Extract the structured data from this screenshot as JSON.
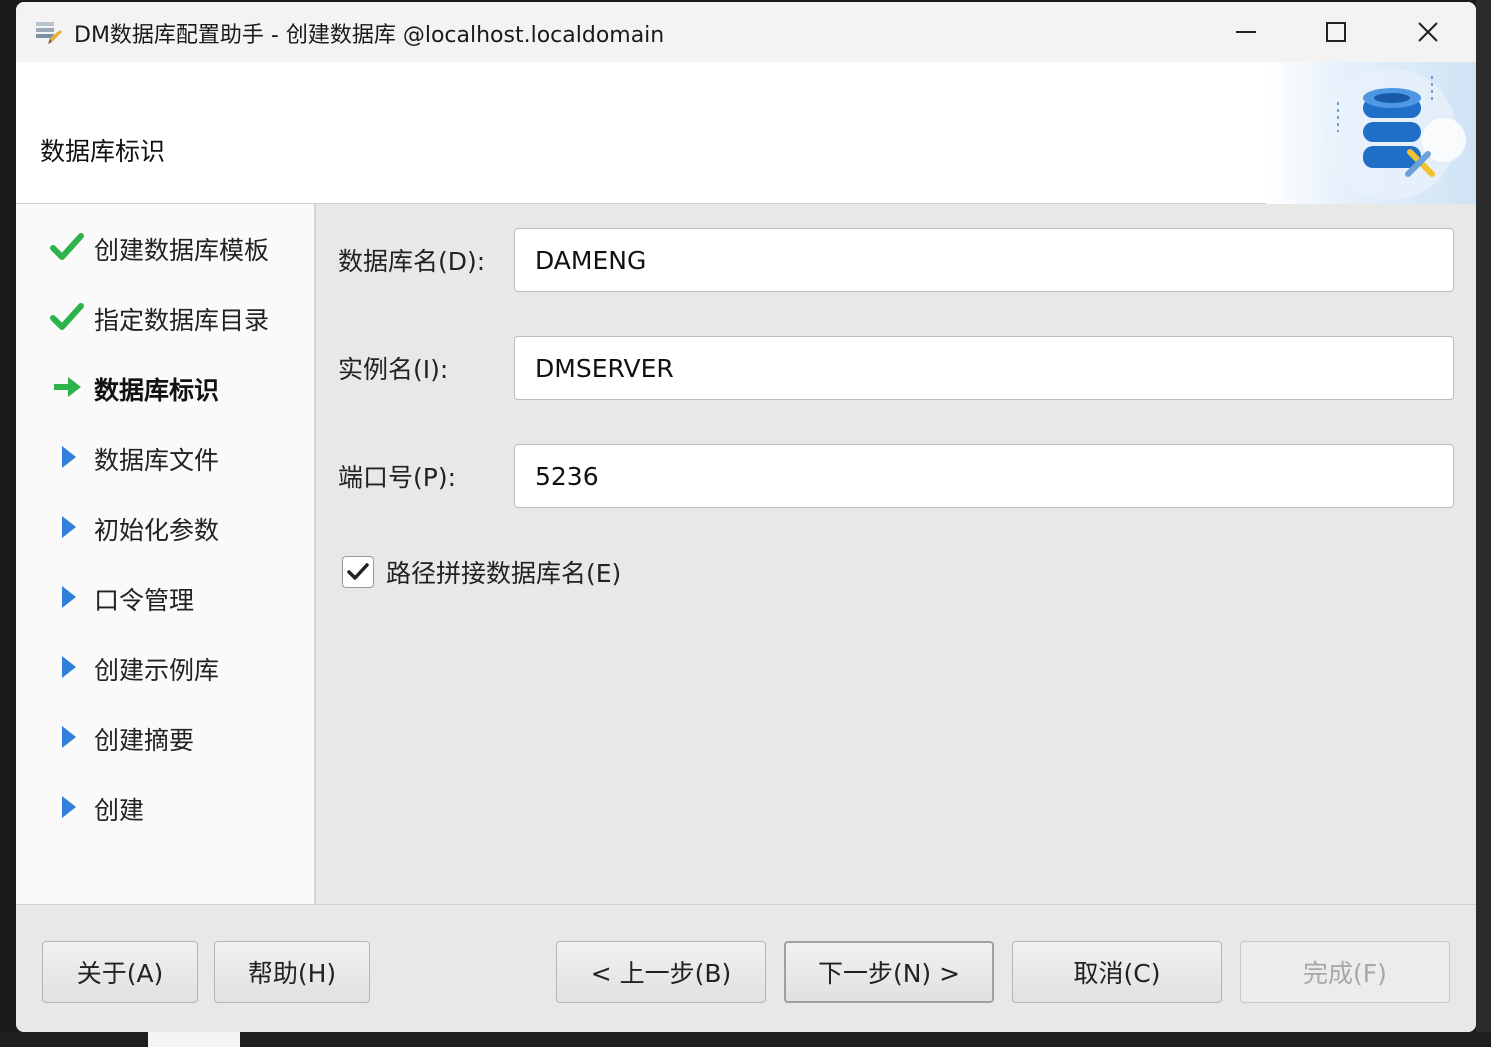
{
  "window": {
    "title": "DM数据库配置助手 - 创建数据库 @localhost.localdomain"
  },
  "header": {
    "title": "数据库标识"
  },
  "sidebar": {
    "steps": [
      {
        "label": "创建数据库模板",
        "state": "done"
      },
      {
        "label": "指定数据库目录",
        "state": "done"
      },
      {
        "label": "数据库标识",
        "state": "current"
      },
      {
        "label": "数据库文件",
        "state": "pending"
      },
      {
        "label": "初始化参数",
        "state": "pending"
      },
      {
        "label": "口令管理",
        "state": "pending"
      },
      {
        "label": "创建示例库",
        "state": "pending"
      },
      {
        "label": "创建摘要",
        "state": "pending"
      },
      {
        "label": "创建",
        "state": "pending"
      }
    ]
  },
  "form": {
    "db_name": {
      "label": "数据库名(D):",
      "value": "DAMENG"
    },
    "instance_name": {
      "label": "实例名(I):",
      "value": "DMSERVER"
    },
    "port": {
      "label": "端口号(P):",
      "value": "5236"
    },
    "path_concat": {
      "label": "路径拼接数据库名(E)",
      "checked": true
    }
  },
  "footer": {
    "about": "关于(A)",
    "help": "帮助(H)",
    "prev": "< 上一步(B)",
    "next": "下一步(N) >",
    "cancel": "取消(C)",
    "finish": "完成(F)"
  },
  "colors": {
    "done": "#2db34a",
    "current": "#2db34a",
    "pending": "#2f80d8",
    "accent": "#1f6fc9"
  },
  "icons": {
    "done": "check-icon",
    "current": "arrow-right-icon",
    "pending": "triangle-right-icon"
  }
}
